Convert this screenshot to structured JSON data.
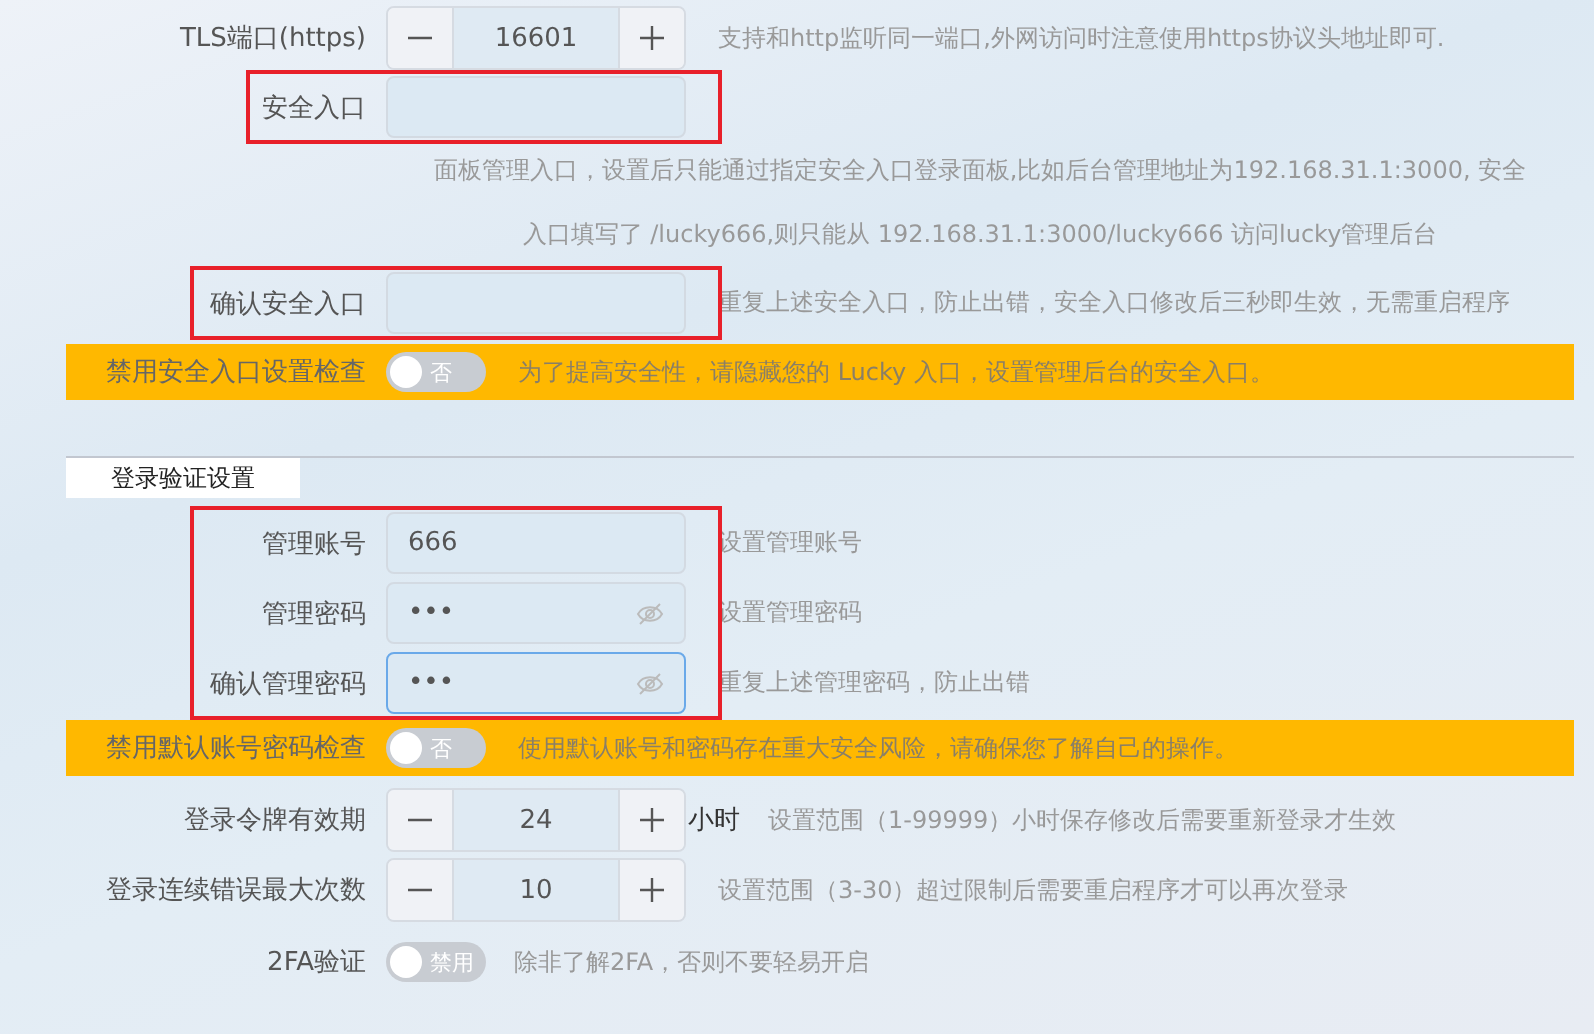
{
  "items": [
    {
      "kind": "stepper",
      "label": "TLS端口(https)",
      "value": "16601",
      "help": "支持和http监听同一端口,外网访问时注意使用https协议头地址即可."
    },
    {
      "kind": "group",
      "highlighted": true,
      "rows": [
        {
          "kind": "text",
          "label": "安全入口",
          "value": ""
        }
      ]
    },
    {
      "kind": "paragraph",
      "lines": [
        "面板管理入口，设置后只能通过指定安全入口登录面板,比如后台管理地址为192.168.31.1:3000, 安全",
        "入口填写了 /lucky666,则只能从 192.168.31.1:3000/lucky666 访问lucky管理后台"
      ]
    },
    {
      "kind": "group",
      "highlighted": true,
      "rows": [
        {
          "kind": "text",
          "label": "确认安全入口",
          "value": "",
          "help": "重复上述安全入口，防止出错，安全入口修改后三秒即生效，无需重启程序"
        }
      ]
    },
    {
      "kind": "warning",
      "label": "禁用安全入口设置检查",
      "toggle": {
        "on": false,
        "text": "否"
      },
      "help": "为了提高安全性，请隐藏您的 Lucky 入口，设置管理后台的安全入口。"
    },
    {
      "kind": "section",
      "title": "登录验证设置"
    },
    {
      "kind": "group",
      "highlighted": true,
      "rows": [
        {
          "kind": "text",
          "label": "管理账号",
          "value": "666",
          "help": "设置管理账号"
        },
        {
          "kind": "password",
          "label": "管理密码",
          "value": "•••",
          "focused": false,
          "help": "设置管理密码"
        },
        {
          "kind": "password",
          "label": "确认管理密码",
          "value": "•••",
          "focused": true,
          "help": "重复上述管理密码，防止出错"
        }
      ]
    },
    {
      "kind": "warning",
      "label": "禁用默认账号密码检查",
      "toggle": {
        "on": false,
        "text": "否"
      },
      "help": "使用默认账号和密码存在重大安全风险，请确保您了解自己的操作。"
    },
    {
      "kind": "stepper",
      "label": "登录令牌有效期",
      "value": "24",
      "unit": "小时",
      "help": "设置范围（1-99999）小时保存修改后需要重新登录才生效"
    },
    {
      "kind": "stepper",
      "label": "登录连续错误最大次数",
      "value": "10",
      "help": "设置范围（3-30）超过限制后需要重启程序才可以再次登录"
    },
    {
      "kind": "switch",
      "label": "2FA验证",
      "toggle": {
        "on": false,
        "text": "禁用"
      },
      "help": "除非了解2FA，否则不要轻易开启"
    }
  ]
}
